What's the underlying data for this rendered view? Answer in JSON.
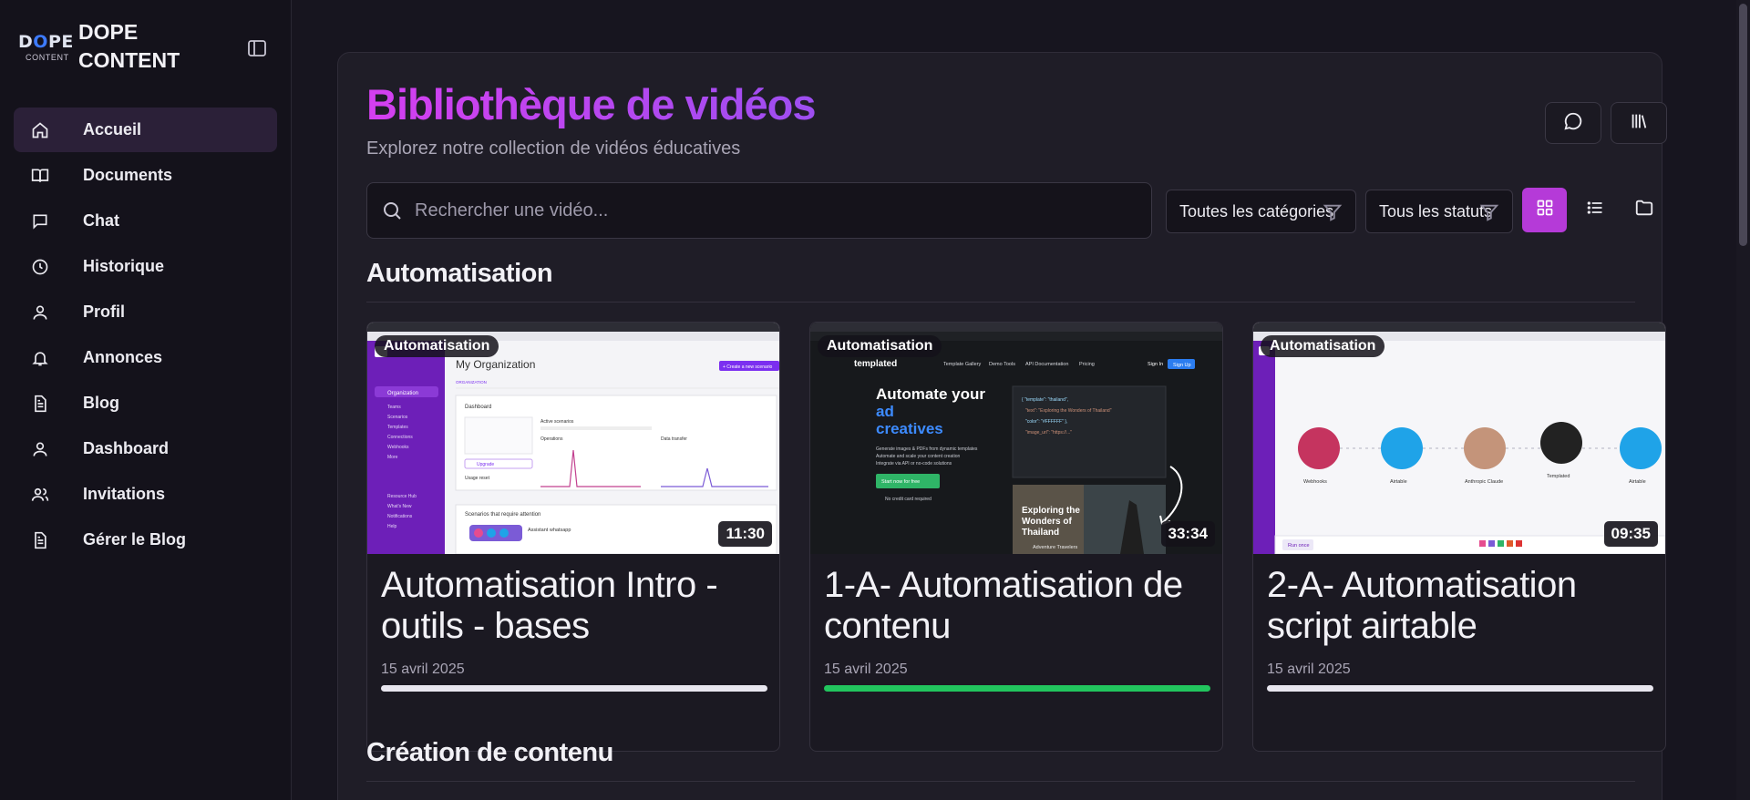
{
  "brand": {
    "logo_top": "DOPE",
    "logo_bottom": "CONTENT",
    "name_line1": "DOPE",
    "name_line2": "CONTENT"
  },
  "sidebar": {
    "items": [
      {
        "label": "Accueil",
        "icon": "home-icon",
        "active": true
      },
      {
        "label": "Documents",
        "icon": "book-open-icon"
      },
      {
        "label": "Chat",
        "icon": "chat-bubble-icon"
      },
      {
        "label": "Historique",
        "icon": "clock-icon"
      },
      {
        "label": "Profil",
        "icon": "user-icon"
      },
      {
        "label": "Annonces",
        "icon": "bell-icon"
      },
      {
        "label": "Blog",
        "icon": "document-icon"
      },
      {
        "label": "Dashboard",
        "icon": "user-icon"
      },
      {
        "label": "Invitations",
        "icon": "users-icon"
      },
      {
        "label": "Gérer le Blog",
        "icon": "document-icon"
      }
    ]
  },
  "header": {
    "title": "Bibliothèque de vidéos",
    "subtitle": "Explorez notre collection de vidéos éducatives"
  },
  "search": {
    "placeholder": "Rechercher une vidéo..."
  },
  "filters": {
    "category": "Toutes les catégories",
    "status": "Tous les statuts"
  },
  "sections": [
    {
      "title": "Automatisation",
      "videos": [
        {
          "category": "Automatisation",
          "title": "Automatisation Intro - outils - bases",
          "date": "15 avril 2025",
          "duration": "11:30",
          "progress": 0
        },
        {
          "category": "Automatisation",
          "title": "1-A- Automatisation de contenu",
          "date": "15 avril 2025",
          "duration": "33:34",
          "progress": 1
        },
        {
          "category": "Automatisation",
          "title": "2-A- Automatisation script airtable",
          "date": "15 avril 2025",
          "duration": "09:35",
          "progress": 0
        }
      ]
    },
    {
      "title": "Création de contenu"
    }
  ],
  "thumbnails": {
    "t1": {
      "header": "My Organization",
      "tab": "ORGANIZATION",
      "side_items": [
        "Organization",
        "Teams",
        "Scenarios",
        "Templates",
        "Connections",
        "Webhooks",
        "More",
        "Resource Hub",
        "What's New",
        "Notifications",
        "Help"
      ],
      "panel1": "Dashboard",
      "label_active": "Active scenarios",
      "label_ops": "Operations",
      "label_data": "Data transfer",
      "upgrade": "Upgrade",
      "usage": "Usage reset",
      "attention": "Scenarios that require attention",
      "assistant": "Assistant whatsapp",
      "create_btn": "+ Create a new scenario"
    },
    "t2": {
      "brand": "templated",
      "nav": [
        "Template Gallery",
        "Demo Tools",
        "API Documentation",
        "Pricing"
      ],
      "signin": "Sign In",
      "signup": "Sign Up",
      "hero1": "Automate your",
      "hero2": "ad",
      "hero3": "creatives",
      "bullets": [
        "Generate images & PDFs from dynamic templates",
        "Automate and scale your content creation",
        "Integrate via API or no-code solutions"
      ],
      "cta": "Start now for free",
      "nocard": "No credit card required",
      "card_title": "Exploring the Wonders of Thailand",
      "card_author": "Adventure Travelers"
    },
    "t3": {
      "nodes": [
        "Webhooks",
        "Airtable",
        "Anthropic Claude",
        "Templated",
        "Airtable"
      ],
      "run": "Run once"
    }
  },
  "colors": {
    "accent": "#b53ad8",
    "title_gradient_start": "#d53ff0",
    "title_gradient_end": "#9d4ef0",
    "progress_complete": "#22c55e",
    "active_nav": "#2b2038"
  }
}
